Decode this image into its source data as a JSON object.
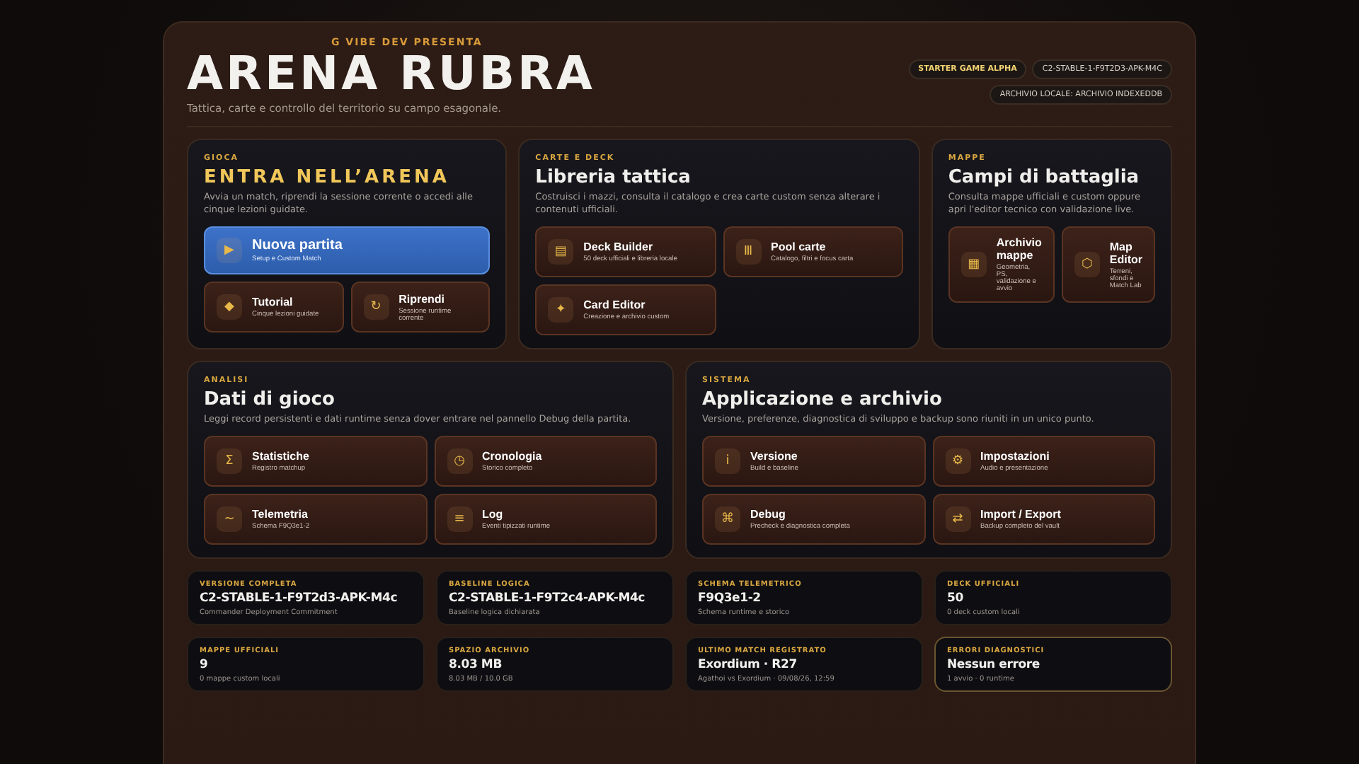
{
  "header": {
    "presenter": "G VIBE DEV PRESENTA",
    "title": "ARENA RUBRA",
    "subtitle": "Tattica, carte e controllo del territorio su campo esagonale.",
    "badges": [
      {
        "label": "STARTER GAME ALPHA",
        "kind": "accent"
      },
      {
        "label": "C2-STABLE-1-F9T2D3-APK-M4C",
        "kind": "plain"
      },
      {
        "label": "ARCHIVIO LOCALE: ARCHIVIO INDEXEDDB",
        "kind": "plain"
      }
    ]
  },
  "rows": [
    {
      "cards": [
        {
          "eyebrow": "GIOCA",
          "title": "ENTRA NELL’ARENA",
          "kind": "hero",
          "description": "Avvia un match, riprendi la sessione corrente o accedi alle cinque lezioni guidate.",
          "actions": [
            {
              "icon": "▶",
              "label": "Nuova partita",
              "sub": "Setup e Custom Match",
              "kind": "primary"
            },
            {
              "icon": "◆",
              "label": "Tutorial",
              "sub": "Cinque lezioni guidate",
              "kind": "normal"
            },
            {
              "icon": "↻",
              "label": "Riprendi",
              "sub": "Sessione runtime corrente",
              "kind": "normal"
            }
          ]
        },
        {
          "eyebrow": "CARTE E DECK",
          "title": "Libreria tattica",
          "kind": "plain",
          "description": "Costruisci i mazzi, consulta il catalogo e crea carte custom senza alterare i contenuti ufficiali.",
          "actions": [
            {
              "icon": "▤",
              "label": "Deck Builder",
              "sub": "50 deck ufficiali e libreria locale",
              "kind": "normal"
            },
            {
              "icon": "Ⅲ",
              "label": "Pool carte",
              "sub": "Catalogo, filtri e focus carta",
              "kind": "normal"
            },
            {
              "icon": "✦",
              "label": "Card Editor",
              "sub": "Creazione e archivio custom",
              "kind": "normal"
            }
          ]
        },
        {
          "eyebrow": "MAPPE",
          "title": "Campi di battaglia",
          "kind": "plain",
          "description": "Consulta mappe ufficiali e custom oppure apri l'editor tecnico con validazione live.",
          "actions": [
            {
              "icon": "▦",
              "label": "Archivio mappe",
              "sub": "Geometria, PS, validazione e avvio",
              "kind": "normal"
            },
            {
              "icon": "⬡",
              "label": "Map Editor",
              "sub": "Terreni, sfondi e Match Lab",
              "kind": "normal"
            }
          ]
        }
      ]
    },
    {
      "cards": [
        {
          "eyebrow": "ANALISI",
          "title": "Dati di gioco",
          "kind": "plain",
          "description": "Leggi record persistenti e dati runtime senza dover entrare nel pannello Debug della partita.",
          "actions": [
            {
              "icon": "Σ",
              "label": "Statistiche",
              "sub": "Registro matchup",
              "kind": "normal"
            },
            {
              "icon": "◷",
              "label": "Cronologia",
              "sub": "Storico completo",
              "kind": "normal"
            },
            {
              "icon": "~",
              "label": "Telemetria",
              "sub": "Schema F9Q3e1-2",
              "kind": "normal"
            },
            {
              "icon": "≡",
              "label": "Log",
              "sub": "Eventi tipizzati runtime",
              "kind": "normal"
            }
          ]
        },
        {
          "eyebrow": "SISTEMA",
          "title": "Applicazione e archivio",
          "kind": "plain",
          "description": "Versione, preferenze, diagnostica di sviluppo e backup sono riuniti in un unico punto.",
          "actions": [
            {
              "icon": "i",
              "label": "Versione",
              "sub": "Build e baseline",
              "kind": "normal"
            },
            {
              "icon": "⚙",
              "label": "Impostazioni",
              "sub": "Audio e presentazione",
              "kind": "normal"
            },
            {
              "icon": "⌘",
              "label": "Debug",
              "sub": "Precheck e diagnostica completa",
              "kind": "normal"
            },
            {
              "icon": "⇄",
              "label": "Import / Export",
              "sub": "Backup completo del vault",
              "kind": "normal"
            }
          ]
        }
      ]
    }
  ],
  "stats": [
    {
      "label": "VERSIONE COMPLETA",
      "value": "C2-STABLE-1-F9T2d3-APK-M4c",
      "note": "Commander Deployment Commitment",
      "highlighted": false
    },
    {
      "label": "BASELINE LOGICA",
      "value": "C2-STABLE-1-F9T2c4-APK-M4c",
      "note": "Baseline logica dichiarata",
      "highlighted": false
    },
    {
      "label": "SCHEMA TELEMETRICO",
      "value": "F9Q3e1-2",
      "note": "Schema runtime e storico",
      "highlighted": false
    },
    {
      "label": "DECK UFFICIALI",
      "value": "50",
      "note": "0 deck custom locali",
      "highlighted": false
    },
    {
      "label": "MAPPE UFFICIALI",
      "value": "9",
      "note": "0 mappe custom locali",
      "highlighted": false
    },
    {
      "label": "SPAZIO ARCHIVIO",
      "value": "8.03 MB",
      "note": "8.03 MB / 10.0 GB",
      "highlighted": false
    },
    {
      "label": "ULTIMO MATCH REGISTRATO",
      "value": "Exordium · R27",
      "note": "Agathoi vs Exordium · 09/08/26, 12:59",
      "highlighted": false
    },
    {
      "label": "ERRORI DIAGNOSTICI",
      "value": "Nessun errore",
      "note": "1 avvio · 0 runtime",
      "highlighted": true
    }
  ]
}
